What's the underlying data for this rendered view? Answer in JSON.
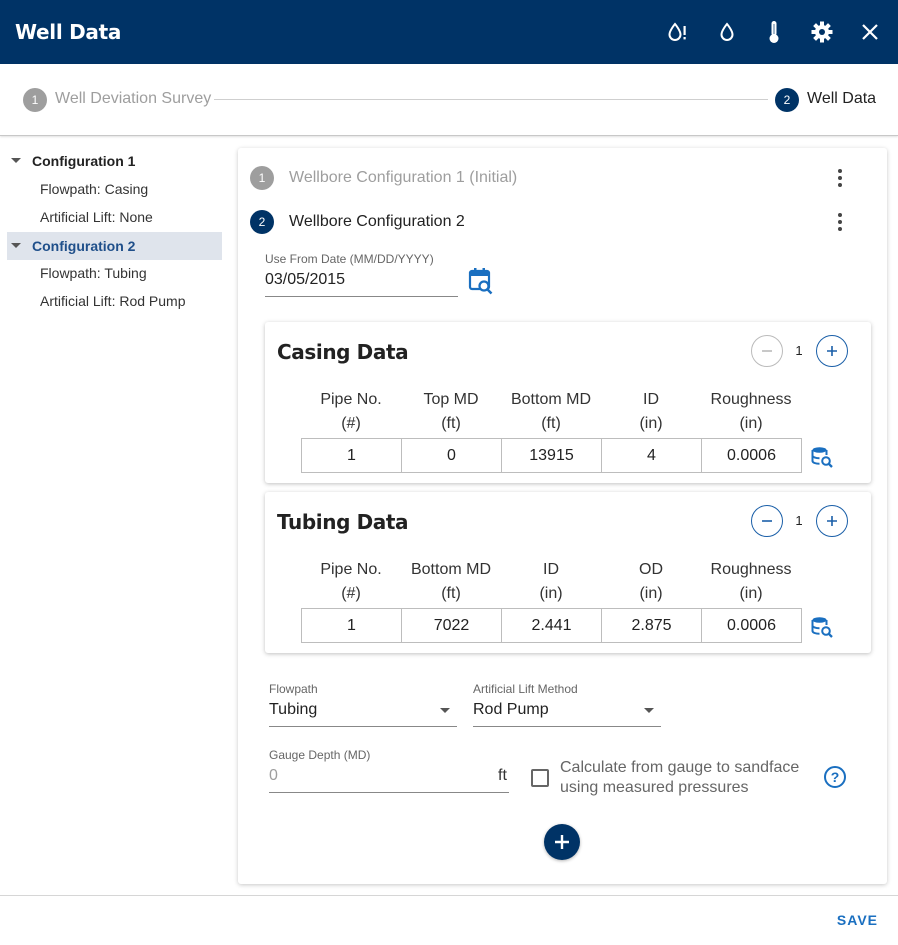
{
  "header": {
    "title": "Well Data",
    "icons": [
      "water-alert-icon",
      "water-drop-icon",
      "thermometer-icon",
      "gear-icon",
      "close-icon"
    ]
  },
  "stepper": {
    "steps": [
      {
        "number": "1",
        "label": "Well Deviation Survey"
      },
      {
        "number": "2",
        "label": "Well Data"
      }
    ]
  },
  "sidebar": {
    "configs": [
      {
        "label": "Configuration 1",
        "children": [
          "Flowpath: Casing",
          "Artificial Lift: None"
        ]
      },
      {
        "label": "Configuration 2",
        "children": [
          "Flowpath: Tubing",
          "Artificial Lift: Rod Pump"
        ]
      }
    ]
  },
  "wellbore": {
    "configs": [
      {
        "number": "1",
        "label": "Wellbore Configuration 1 (Initial)"
      },
      {
        "number": "2",
        "label": "Wellbore Configuration 2"
      }
    ],
    "date_label": "Use From Date (MM/DD/YYYY)",
    "date_value": "03/05/2015"
  },
  "casing": {
    "title": "Casing Data",
    "count": "1",
    "headers": [
      [
        "Pipe No.",
        "(#)"
      ],
      [
        "Top MD",
        "(ft)"
      ],
      [
        "Bottom MD",
        "(ft)"
      ],
      [
        "ID",
        "(in)"
      ],
      [
        "Roughness",
        "(in)"
      ]
    ],
    "row": [
      "1",
      "0",
      "13915",
      "4",
      "0.0006"
    ]
  },
  "tubing": {
    "title": "Tubing Data",
    "count": "1",
    "headers": [
      [
        "Pipe No.",
        "(#)"
      ],
      [
        "Bottom MD",
        "(ft)"
      ],
      [
        "ID",
        "(in)"
      ],
      [
        "OD",
        "(in)"
      ],
      [
        "Roughness",
        "(in)"
      ]
    ],
    "row": [
      "1",
      "7022",
      "2.441",
      "2.875",
      "0.0006"
    ]
  },
  "form": {
    "flowpath_label": "Flowpath",
    "flowpath_value": "Tubing",
    "lift_label": "Artificial Lift Method",
    "lift_value": "Rod Pump",
    "gauge_label": "Gauge Depth (MD)",
    "gauge_placeholder": "0",
    "gauge_unit": "ft",
    "calc_label_line1": "Calculate from gauge to sandface",
    "calc_label_line2": "using measured pressures",
    "help": "?"
  },
  "footer": {
    "save_label": "SAVE"
  },
  "colors": {
    "primary": "#003366",
    "accent": "#1a6fc0",
    "inactive": "#9e9e9e",
    "selected_bg": "#dfe4ec"
  }
}
